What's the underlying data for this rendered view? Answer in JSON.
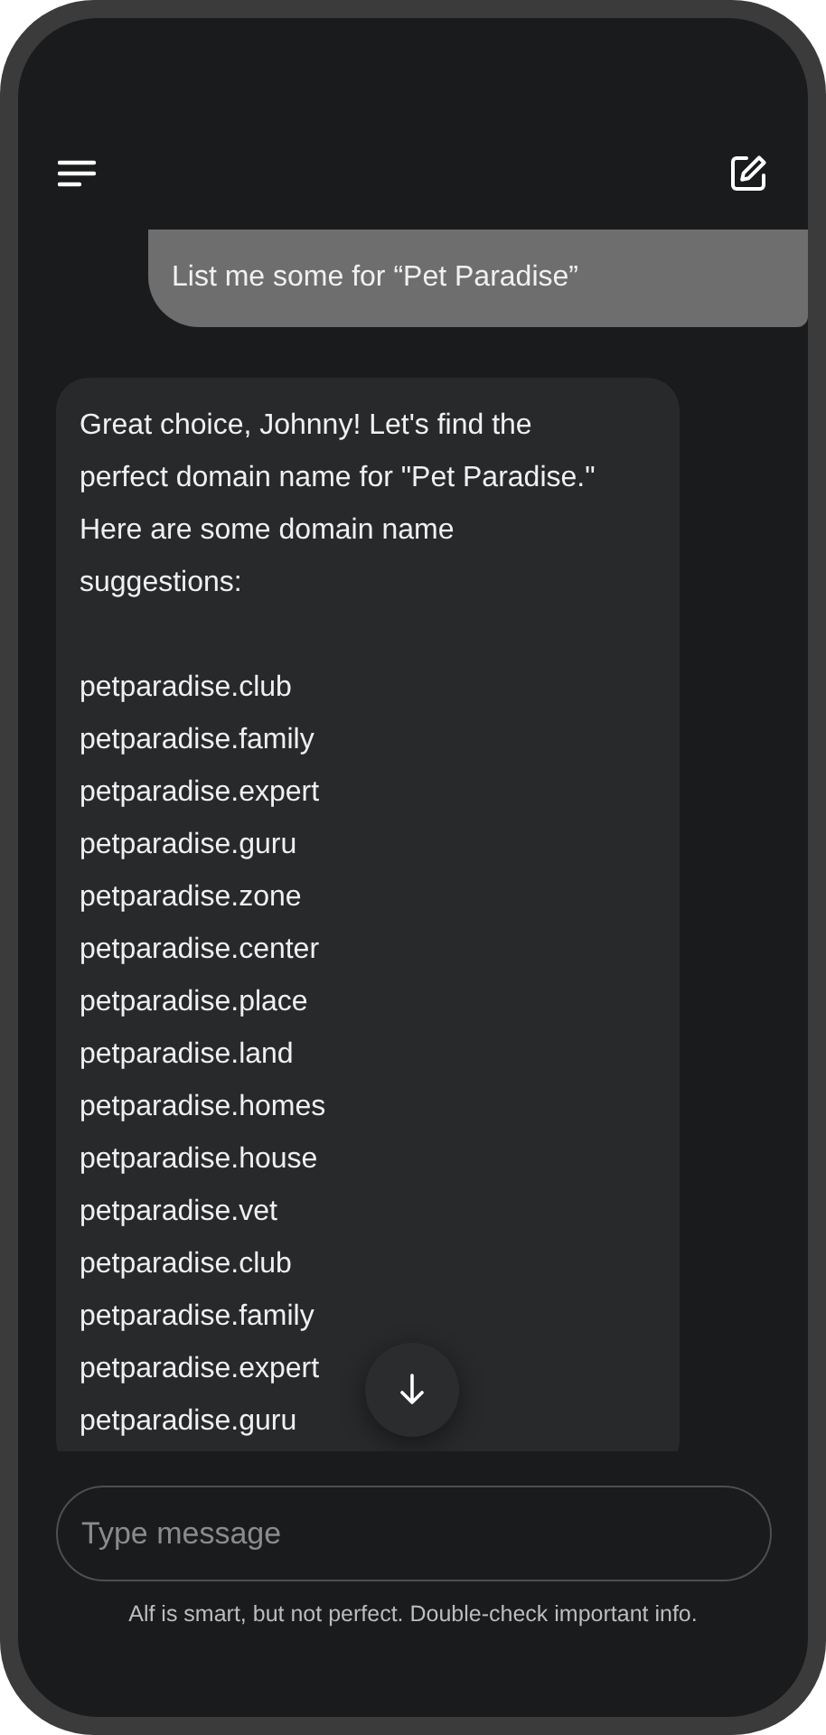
{
  "messages": [
    {
      "kind": "user",
      "lines": [
        "List me some for “Pet Paradise”"
      ]
    },
    {
      "kind": "assistant",
      "intro": "Great choice, Johnny! Let's find the perfect domain name for \"Pet Paradise.\" Here are some domain name suggestions:",
      "items": [
        "petparadise.club",
        "petparadise.family",
        "petparadise.expert",
        "petparadise.guru",
        "petparadise.zone",
        "petparadise.center",
        "petparadise.place",
        "petparadise.land",
        "petparadise.homes",
        "petparadise.house",
        "petparadise.vet",
        "petparadise.club",
        "petparadise.family",
        "petparadise.expert",
        "petparadise.guru"
      ]
    }
  ],
  "composer": {
    "placeholder": "Type message"
  },
  "disclaimer": "Alf is smart, but not perfect. Double-check important info."
}
